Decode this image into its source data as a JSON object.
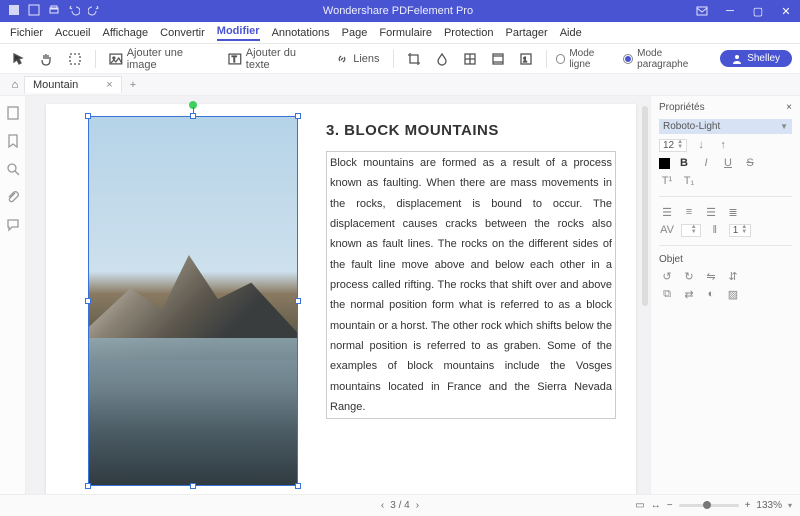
{
  "app": {
    "title": "Wondershare PDFelement Pro"
  },
  "menu": [
    "Fichier",
    "Accueil",
    "Affichage",
    "Convertir",
    "Modifier",
    "Annotations",
    "Page",
    "Formulaire",
    "Protection",
    "Partager",
    "Aide"
  ],
  "menu_active": "Modifier",
  "toolbar": {
    "add_image": "Ajouter une image",
    "add_text": "Ajouter du texte",
    "links": "Liens",
    "mode_line": "Mode ligne",
    "mode_paragraph": "Mode paragraphe"
  },
  "user": "Shelley",
  "tab": {
    "name": "Mountain"
  },
  "document": {
    "heading": "3. BLOCK MOUNTAINS",
    "body": "Block mountains are formed as a result of a process known as faulting. When there are mass movements in the rocks, displacement is bound to occur. The displacement causes cracks between the rocks also known as fault lines. The rocks on the different sides of the fault line move above and below each other in a process called rifting. The rocks that shift over and above the normal position form what is referred to as a block mountain or a horst. The other rock which shifts below the normal position is referred to as graben. Some of the examples of block mountains include the Vosges mountains located in France and the Sierra Nevada Range."
  },
  "properties": {
    "title": "Propriétés",
    "font": "Roboto-Light",
    "size": "12",
    "format": {
      "bold": "B",
      "italic": "I",
      "underline": "U",
      "strike": "S",
      "super": "T¹",
      "sub": "T₁"
    },
    "spacing_label": "1",
    "object_label": "Objet"
  },
  "status": {
    "page_current": "3",
    "page_total": "4",
    "zoom": "133%"
  }
}
